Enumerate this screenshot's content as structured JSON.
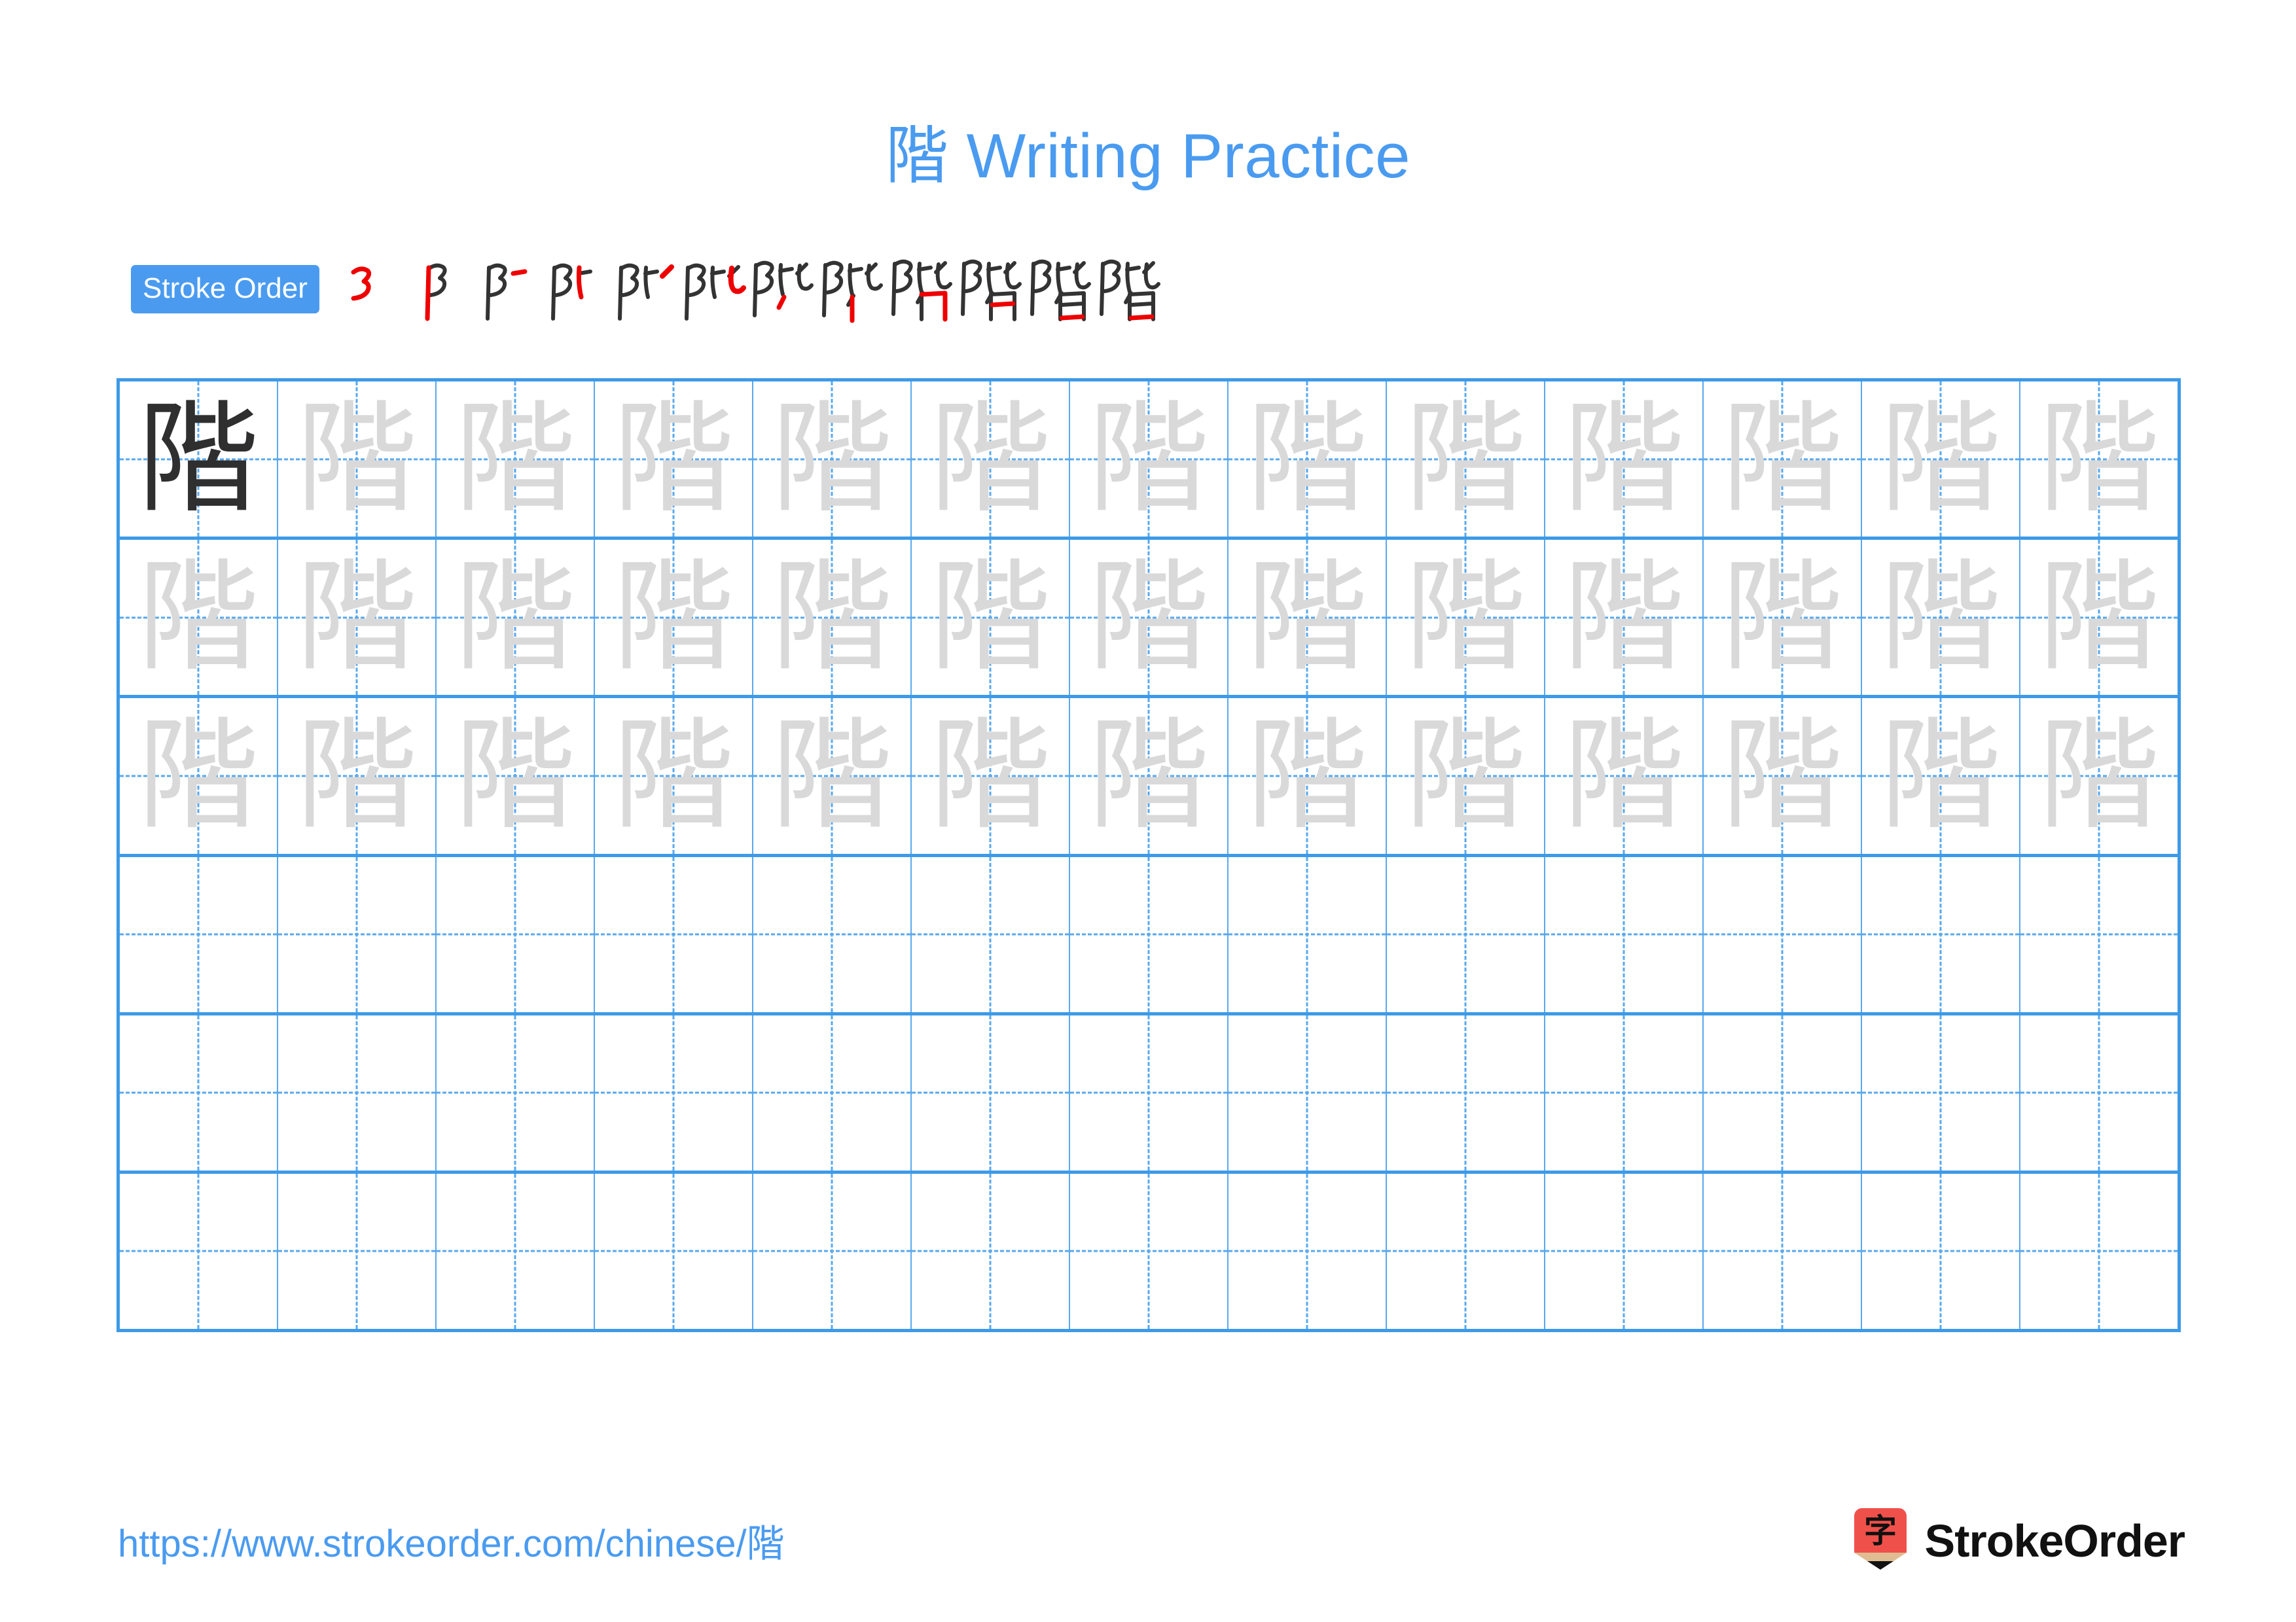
{
  "page": {
    "character": "階",
    "title": "階 Writing Practice",
    "title_character": "階",
    "title_text": " Writing Practice",
    "accent_color": "#4a9bf0",
    "grid_line_color": "#3d9ae8",
    "guide_line_color": "#59a8ee",
    "model_char_color": "#2f2f2f",
    "trace_char_color": "#d9d9d9",
    "stroke_new_color": "#ee0000",
    "stroke_old_color": "#333333"
  },
  "stroke_order": {
    "label": "Stroke Order",
    "total_strokes": 12,
    "steps": [
      {
        "index": 1,
        "new_stroke": "横撇弯钩",
        "glyph": "⻖"
      },
      {
        "index": 2,
        "new_stroke": "竖",
        "glyph": "阝"
      },
      {
        "index": 3,
        "new_stroke": "横",
        "glyph": "阝-"
      },
      {
        "index": 4,
        "new_stroke": "竖",
        "glyph": "阝比"
      },
      {
        "index": 5,
        "new_stroke": "撇",
        "glyph": "阝比ノ"
      },
      {
        "index": 6,
        "new_stroke": "竖弯钩",
        "glyph": "陛"
      },
      {
        "index": 7,
        "new_stroke": "撇",
        "glyph": "陛ノ"
      },
      {
        "index": 8,
        "new_stroke": "竖",
        "glyph": "陛丨"
      },
      {
        "index": 9,
        "new_stroke": "横折",
        "glyph": "階"
      },
      {
        "index": 10,
        "new_stroke": "横",
        "glyph": "階"
      },
      {
        "index": 11,
        "new_stroke": "横",
        "glyph": "階"
      },
      {
        "index": 12,
        "new_stroke": "横",
        "glyph": "階"
      }
    ]
  },
  "practice_grid": {
    "columns": 13,
    "rows": 6,
    "cells": [
      [
        "model",
        "trace",
        "trace",
        "trace",
        "trace",
        "trace",
        "trace",
        "trace",
        "trace",
        "trace",
        "trace",
        "trace",
        "trace"
      ],
      [
        "trace",
        "trace",
        "trace",
        "trace",
        "trace",
        "trace",
        "trace",
        "trace",
        "trace",
        "trace",
        "trace",
        "trace",
        "trace"
      ],
      [
        "trace",
        "trace",
        "trace",
        "trace",
        "trace",
        "trace",
        "trace",
        "trace",
        "trace",
        "trace",
        "trace",
        "trace",
        "trace"
      ],
      [
        "blank",
        "blank",
        "blank",
        "blank",
        "blank",
        "blank",
        "blank",
        "blank",
        "blank",
        "blank",
        "blank",
        "blank",
        "blank"
      ],
      [
        "blank",
        "blank",
        "blank",
        "blank",
        "blank",
        "blank",
        "blank",
        "blank",
        "blank",
        "blank",
        "blank",
        "blank",
        "blank"
      ],
      [
        "blank",
        "blank",
        "blank",
        "blank",
        "blank",
        "blank",
        "blank",
        "blank",
        "blank",
        "blank",
        "blank",
        "blank",
        "blank"
      ]
    ]
  },
  "footer": {
    "url": "https://www.strokeorder.com/chinese/階",
    "brand_name": "StrokeOrder",
    "logo_char": "字",
    "logo_body_color": "#f0504a",
    "logo_wood_color": "#e0bc93",
    "logo_tip_color": "#111111"
  }
}
